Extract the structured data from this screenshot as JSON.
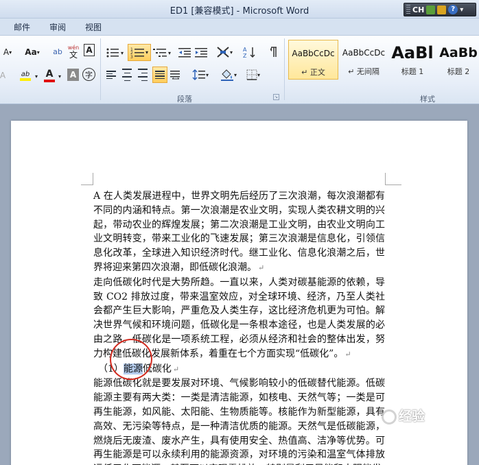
{
  "window": {
    "title": "ED1 [兼容模式] - Microsoft Word",
    "lang_bar": {
      "ch": "CH",
      "help": "?"
    }
  },
  "tabs": [
    "邮件",
    "审阅",
    "视图"
  ],
  "ribbon": {
    "font_group": {
      "grow_font": "A",
      "change_case": "Aa",
      "highlight": "ab",
      "font_color": "A",
      "char_shade": "A",
      "encircle": "字",
      "phonetic": "wén",
      "char_border": "A",
      "phonetic_glyph": "文"
    },
    "paragraph_group": {
      "label": "段落"
    },
    "styles_group": {
      "label": "样式",
      "styles": [
        {
          "preview": "AaBbCcDc",
          "name": "↵ 正文",
          "active": true
        },
        {
          "preview": "AaBbCcDc",
          "name": "↵ 无间隔",
          "active": false
        },
        {
          "preview": "AaBl",
          "name": "标题 1",
          "active": false
        },
        {
          "preview": "AaBb",
          "name": "标题 2",
          "active": false
        }
      ]
    }
  },
  "document": {
    "paragraphs": [
      "A 在人类发展进程中，世界文明先后经历了三次浪潮，每次浪潮都有不同的内涵和特点。第一次浪潮是农业文明，实现人类农耕文明的兴起，带动农业的辉煌发展；第二次浪潮是工业文明，由农业文明向工业文明转变，带来工业化的飞速发展；第三次浪潮是信息化，引领信息化改革，全球进入知识经济时代。继工业化、信息化浪潮之后，世界将迎来第四次浪潮，即低碳化浪潮。",
      "走向低碳化时代是大势所趋。一直以来，人类对碳基能源的依赖，导致 CO2 排放过度，带来温室效应，对全球环境、经济，乃至人类社会都产生巨大影响，严重危及人类生存，这比经济危机更为可怕。解决世界气候和环境问题，低碳化是一条根本途径，也是人类发展的必由之路。低碳化是一项系统工程，必须从经济和社会的整体出发，努力构建低碳化发展新体系，着重在七个方面实现“低碳化”。"
    ],
    "heading": {
      "num": "（1）",
      "selected": "能源",
      "rest": "低碳化"
    },
    "paragraph3": "能源低碳化就是要发展对环境、气候影响较小的低碳替代能源。低碳能源主要有两大类：一类是清洁能源，如核电、天然气等；一类是可再生能源，如风能、太阳能、生物质能等。核能作为新型能源，具有高效、无污染等特点，是一种清洁优质的能源。天然气是低碳能源，燃烧后无废渣、废水产生，具有使用安全、热值高、洁净等优势。可再生能源是可以永续利用的能源资源，对环境的污染和温室气体排放远低于化石能源，甚至可以实现零排放，特别是利用风能和太阳能发",
    "para_mark": "↵"
  },
  "watermark": "经验"
}
